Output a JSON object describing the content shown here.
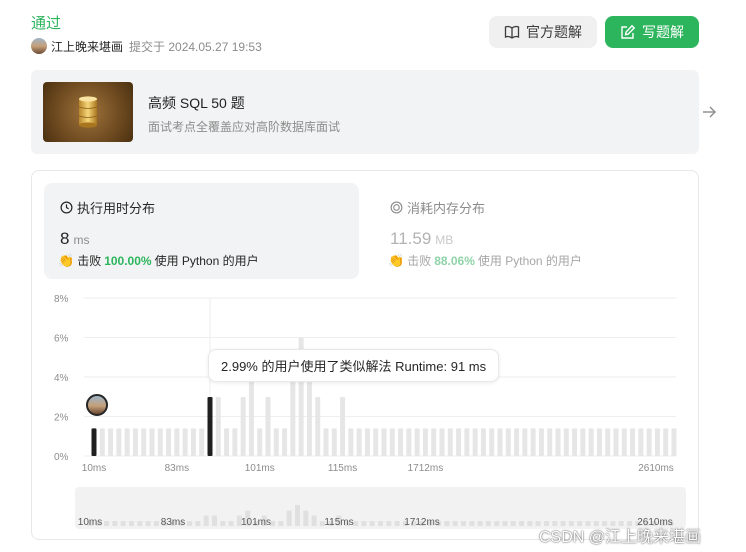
{
  "submission": {
    "status": "通过",
    "user": "江上晚来堪画",
    "submitted_at": "提交于 2024.05.27 19:53"
  },
  "toolbar": {
    "official_solution_label": "官方题解",
    "write_solution_label": "写题解"
  },
  "study_plan": {
    "title": "高频 SQL 50 题",
    "description": "面试考点全覆盖应对高阶数据库面试"
  },
  "runtime_card": {
    "title": "执行用时分布",
    "value": "8",
    "unit": "ms",
    "beats_prefix": "击败",
    "beats_pct": "100.00%",
    "beats_suffix": "使用 Python 的用户"
  },
  "memory_card": {
    "title": "消耗内存分布",
    "value": "11.59",
    "unit": "MB",
    "beats_prefix": "击败",
    "beats_pct": "88.06%",
    "beats_suffix": "使用 Python 的用户"
  },
  "tooltip": "2.99% 的用户使用了类似解法 Runtime: 91 ms",
  "watermark": "CSDN @江上晚来堪画",
  "colors": {
    "accent": "#2db55d",
    "bar": "#e6e6e6",
    "bar_highlight": "#1f1f1f"
  },
  "icons": {
    "official": "book-icon",
    "write": "edit-icon",
    "arrow": "arrow-right-icon",
    "runtime": "clock-icon",
    "memory": "chip-icon",
    "beats": "clap-icon"
  },
  "chart_data": {
    "type": "bar",
    "ylim": [
      0,
      8
    ],
    "y_ticks": [
      "0%",
      "2%",
      "4%",
      "6%",
      "8%"
    ],
    "x_tick_labels": [
      "10ms",
      "83ms",
      "101ms",
      "115ms",
      "1712ms",
      "2610ms"
    ],
    "values": [
      1.4,
      1.4,
      1.4,
      1.4,
      1.4,
      1.4,
      1.4,
      1.4,
      1.4,
      1.4,
      1.4,
      1.4,
      1.4,
      1.4,
      2.99,
      2.99,
      1.4,
      1.4,
      2.99,
      4.4,
      1.4,
      2.99,
      1.4,
      1.4,
      4.4,
      6.0,
      4.4,
      2.99,
      1.4,
      1.4,
      2.99,
      1.4,
      1.4,
      1.4,
      1.4,
      1.4,
      1.4,
      1.4,
      1.4,
      1.4,
      1.4,
      1.4,
      1.4,
      1.4,
      1.4,
      1.4,
      1.4,
      1.4,
      1.4,
      1.4,
      1.4,
      1.4,
      1.4,
      1.4,
      1.4,
      1.4,
      1.4,
      1.4,
      1.4,
      1.4,
      1.4,
      1.4,
      1.4,
      1.4,
      1.4,
      1.4,
      1.4,
      1.4,
      1.4,
      1.4,
      1.4
    ],
    "highlight_index": 0,
    "hover_index": 14,
    "grid": true
  }
}
